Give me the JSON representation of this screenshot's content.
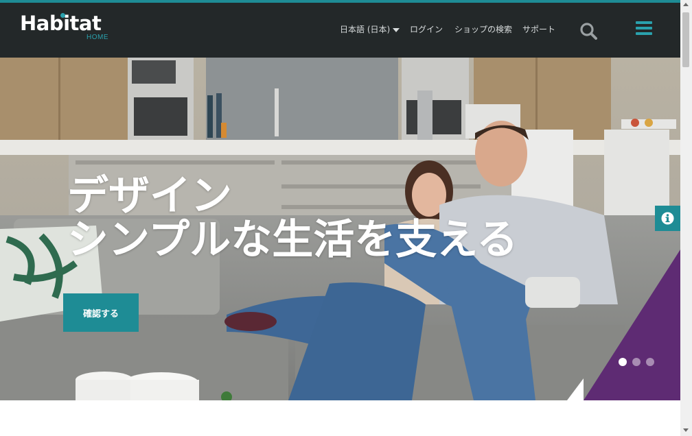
{
  "brand": {
    "name": "Habitat",
    "sub": "HOME"
  },
  "nav": {
    "language": "日本語 (日本)",
    "login": "ログイン",
    "shop_search": "ショップの検索",
    "support": "サポート"
  },
  "icons": {
    "search": "search-icon",
    "menu": "hamburger-menu-icon",
    "info": "info-icon",
    "caret": "caret-down-icon"
  },
  "hero": {
    "title_line1": "デザイン",
    "title_line2": "シンプルな生活を支える",
    "cta_label": "確認する"
  },
  "slider": {
    "slide_count": 3,
    "active_index": 0
  },
  "colors": {
    "accent": "#1e8c95",
    "header_bg": "#232829",
    "purple": "#5e2b73"
  }
}
